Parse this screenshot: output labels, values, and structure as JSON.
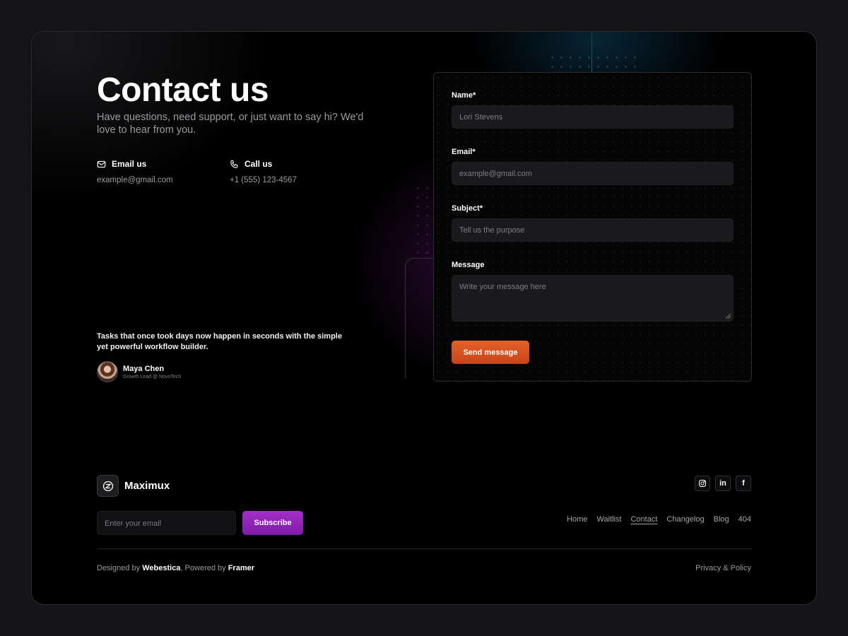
{
  "hero": {
    "title": "Contact us",
    "subtitle": "Have questions, need support, or just want to say hi? We'd love to hear from you."
  },
  "contact": {
    "email_label": "Email us",
    "email_value": "example@gmail.com",
    "phone_label": "Call us",
    "phone_value": "+1 (555) 123-4567"
  },
  "testimonial": {
    "quote": "Tasks that once took days now happen in seconds with the simple yet powerful workflow builder.",
    "name": "Maya Chen",
    "role": "Growth Lead @ NovoTech"
  },
  "form": {
    "name_label": "Name*",
    "name_placeholder": "Lori Stevens",
    "email_label": "Email*",
    "email_placeholder": "example@gmail.com",
    "subject_label": "Subject*",
    "subject_placeholder": "Tell us the purpose",
    "message_label": "Message",
    "message_placeholder": "Write your message here",
    "submit_label": "Send message"
  },
  "footer": {
    "brand_name": "Maximux",
    "email_placeholder": "Enter your email",
    "subscribe_label": "Subscribe",
    "nav": [
      "Home",
      "Waitlist",
      "Contact",
      "Changelog",
      "Blog",
      "404"
    ],
    "active_nav": "Contact",
    "socials": [
      "instagram-icon",
      "linkedin-icon",
      "facebook-icon"
    ],
    "credits_prefix": "Designed by ",
    "credits_designer": "Webestica",
    "credits_middle": ", Powered by ",
    "credits_platform": "Framer",
    "policy": "Privacy & Policy"
  },
  "colors": {
    "background": "#000000",
    "send_button": "#d95424",
    "subscribe_button": "#9223bb"
  }
}
